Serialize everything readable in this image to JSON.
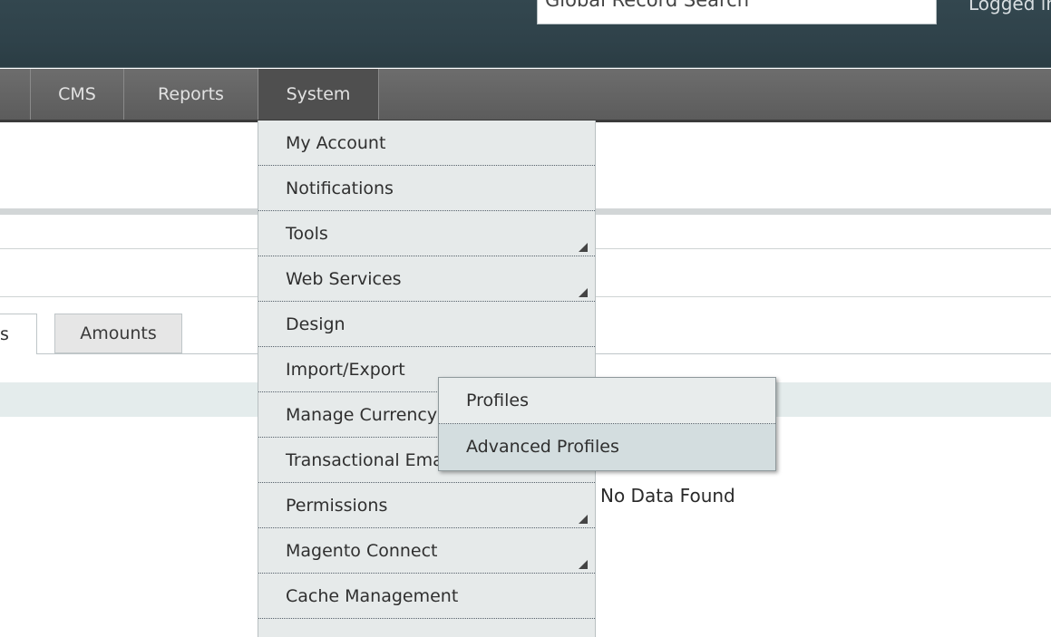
{
  "header": {
    "search_value": "Global Record Search",
    "logged_text": "Logged in"
  },
  "nav": {
    "items": [
      "CMS",
      "Reports",
      "System"
    ],
    "active": "System"
  },
  "tabs": {
    "partial_tab": "s",
    "amounts": "Amounts"
  },
  "grid": {
    "empty_text": "No Data Found"
  },
  "system_menu": {
    "items": [
      {
        "label": "My Account",
        "has_submenu": false
      },
      {
        "label": "Notifications",
        "has_submenu": false
      },
      {
        "label": "Tools",
        "has_submenu": true
      },
      {
        "label": "Web Services",
        "has_submenu": true
      },
      {
        "label": "Design",
        "has_submenu": false
      },
      {
        "label": "Import/Export",
        "has_submenu": false
      },
      {
        "label": "Manage Currency",
        "has_submenu": false
      },
      {
        "label": "Transactional Emails",
        "has_submenu": false
      },
      {
        "label": "Permissions",
        "has_submenu": true
      },
      {
        "label": "Magento Connect",
        "has_submenu": true
      },
      {
        "label": "Cache Management",
        "has_submenu": false
      }
    ]
  },
  "import_export_submenu": {
    "items": [
      "Profiles",
      "Advanced Profiles"
    ],
    "hovered": "Advanced Profiles"
  },
  "icons": {
    "submenu_indicator": "submenu-arrow-icon"
  }
}
